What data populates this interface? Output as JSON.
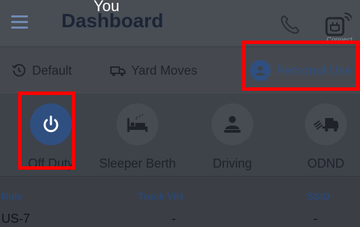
{
  "header": {
    "title": "Dashboard",
    "user_name": "You",
    "connect_label": "Connect"
  },
  "modes": [
    {
      "label": "Default",
      "icon": "history-icon"
    },
    {
      "label": "Yard Moves",
      "icon": "truck-icon"
    },
    {
      "label": "Personal Use",
      "icon": "person-icon",
      "selected": true
    }
  ],
  "statuses": [
    {
      "label": "Off Duty",
      "icon": "power-icon",
      "selected": true
    },
    {
      "label": "Sleeper Berth",
      "icon": "bed-icon"
    },
    {
      "label": "Driving",
      "icon": "driver-icon"
    },
    {
      "label": "ODND",
      "icon": "loading-truck-icon"
    }
  ],
  "info": {
    "rule_header": "Rule",
    "rule_value": "US-7",
    "vin_header": "Truck VIN",
    "vin_value": "-",
    "ssid_header": "SSID",
    "ssid_value": "-"
  },
  "colors": {
    "accent": "#2f4f80",
    "highlight": "#ff0000",
    "background": "#3e4249"
  }
}
